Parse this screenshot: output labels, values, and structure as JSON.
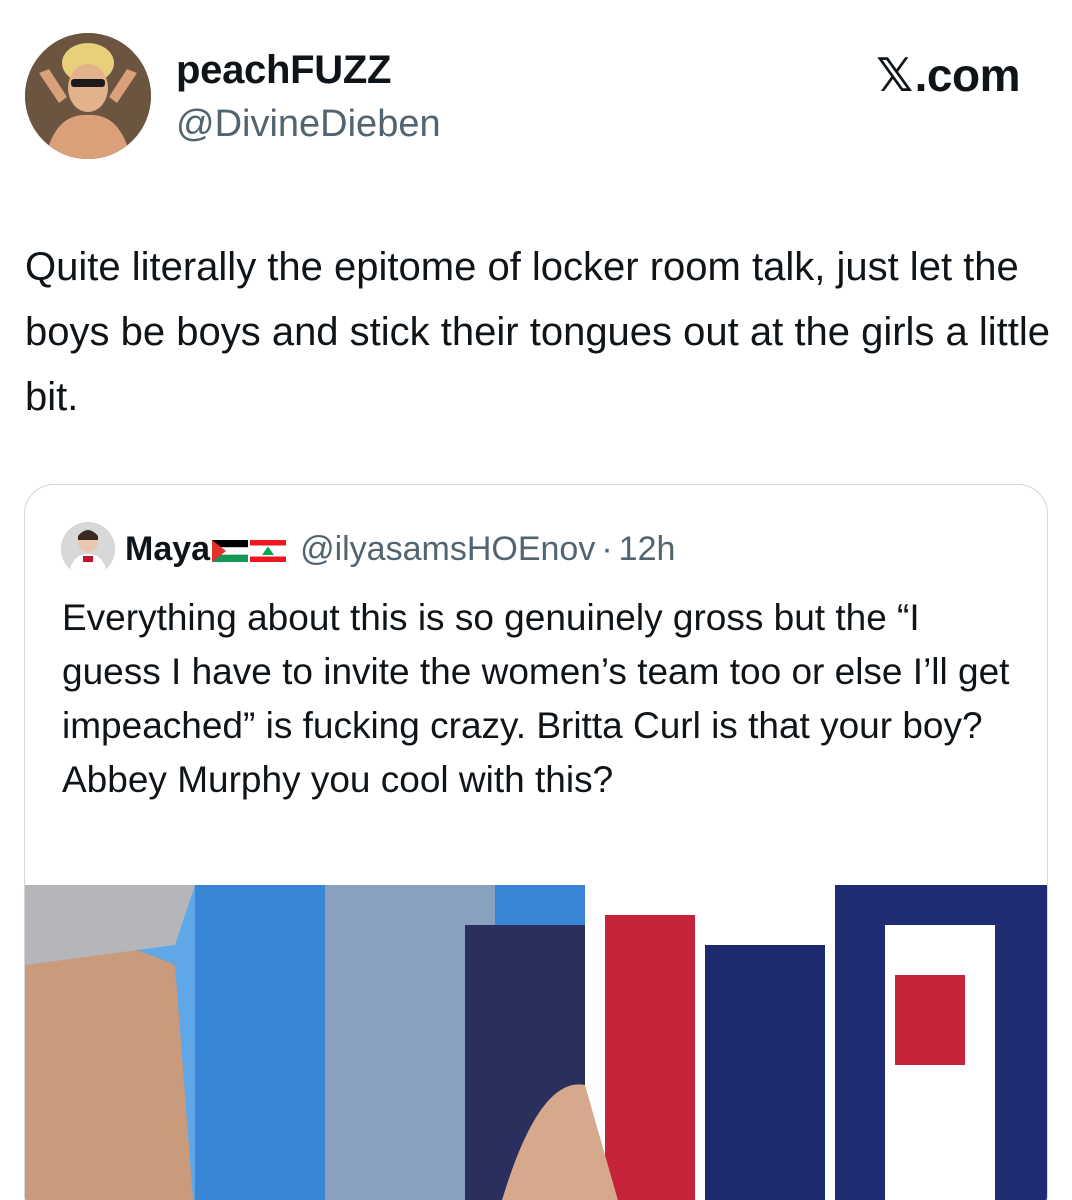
{
  "header": {
    "display_name": "peachFUZZ",
    "handle": "@DivineDieben",
    "watermark": ".com",
    "watermark_icon": "x-logo-icon"
  },
  "tweet": {
    "text": "Quite literally the epitome of locker room talk, just let the boys be boys and stick their tongues out at the girls a little bit."
  },
  "quote": {
    "display_name": "Maya",
    "flags": [
      "palestine-flag-icon",
      "lebanon-flag-icon"
    ],
    "handle": "@ilyasamsHOEnov",
    "separator": "·",
    "time": "12h",
    "text": "Everything about this is so genuinely gross but the “I guess I have to invite the women’s team too or else I’ll get impeached” is fucking crazy. Britta Curl is that your boy? Abbey Murphy you cool with this?"
  },
  "colors": {
    "text": "#0f1419",
    "secondary": "#536471",
    "border": "#cfd9de",
    "media_blue": "#2c3f86"
  }
}
